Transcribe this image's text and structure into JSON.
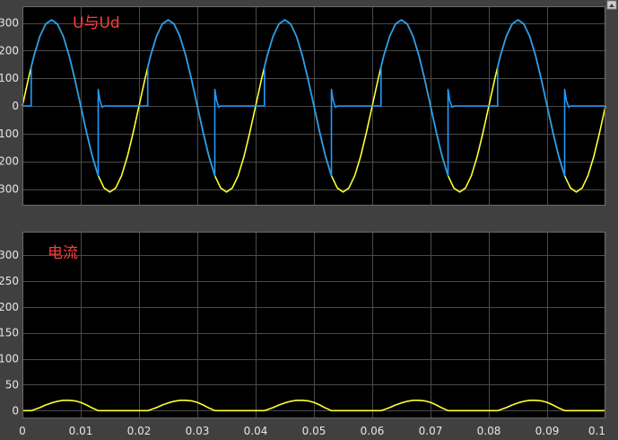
{
  "colors": {
    "background": "#404040",
    "plot_background": "#000000",
    "tick_text": "#e6e6e6",
    "title": "#ff3b3b",
    "yellow": "#ffff33",
    "blue": "#1e9bff"
  },
  "chart_data": [
    {
      "type": "line",
      "title": "U与Ud",
      "xlim": [
        0,
        0.1
      ],
      "ylim": [
        -360,
        360
      ],
      "grid": true,
      "xticks": [
        0,
        0.01,
        0.02,
        0.03,
        0.04,
        0.05,
        0.06,
        0.07,
        0.08,
        0.09,
        0.1
      ],
      "xtick_labels": [
        "0",
        "0.01",
        "0.02",
        "0.03",
        "0.04",
        "0.05",
        "0.06",
        "0.07",
        "0.08",
        "0.09",
        "0.1"
      ],
      "yticks": [
        300,
        200,
        100,
        0,
        -100,
        -200,
        -300
      ],
      "ytick_labels": [
        "300",
        "200",
        "100",
        "0",
        "100",
        "200",
        "300"
      ],
      "series": [
        {
          "color": "yellow",
          "x": [
            0,
            0.001,
            0.002,
            0.003,
            0.004,
            0.005,
            0.006,
            0.007,
            0.008,
            0.009,
            0.01,
            0.011,
            0.012,
            0.013,
            0.014,
            0.015,
            0.016,
            0.017,
            0.018,
            0.019,
            0.02,
            0.021,
            0.022,
            0.023,
            0.024,
            0.025,
            0.026,
            0.027,
            0.028,
            0.029,
            0.03,
            0.031,
            0.032,
            0.033,
            0.034,
            0.035,
            0.036,
            0.037,
            0.038,
            0.039,
            0.04,
            0.041,
            0.042,
            0.043,
            0.044,
            0.045,
            0.046,
            0.047,
            0.048,
            0.049,
            0.05,
            0.051,
            0.052,
            0.053,
            0.054,
            0.055,
            0.056,
            0.057,
            0.058,
            0.059,
            0.06,
            0.061,
            0.062,
            0.063,
            0.064,
            0.065,
            0.066,
            0.067,
            0.068,
            0.069,
            0.07,
            0.071,
            0.072,
            0.073,
            0.074,
            0.075,
            0.076,
            0.077,
            0.078,
            0.079,
            0.08,
            0.081,
            0.082,
            0.083,
            0.084,
            0.085,
            0.086,
            0.087,
            0.088,
            0.089,
            0.09,
            0.091,
            0.092,
            0.093,
            0.094,
            0.095,
            0.096,
            0.097,
            0.098,
            0.099,
            0.1
          ],
          "y": [
            0,
            96,
            183,
            252,
            296,
            311,
            296,
            252,
            183,
            96,
            0,
            -96,
            -183,
            -252,
            -296,
            -311,
            -296,
            -252,
            -183,
            -96,
            0,
            96,
            183,
            252,
            296,
            311,
            296,
            252,
            183,
            96,
            0,
            -96,
            -183,
            -252,
            -296,
            -311,
            -296,
            -252,
            -183,
            -96,
            0,
            96,
            183,
            252,
            296,
            311,
            296,
            252,
            183,
            96,
            0,
            -96,
            -183,
            -252,
            -296,
            -311,
            -296,
            -252,
            -183,
            -96,
            0,
            96,
            183,
            252,
            296,
            311,
            296,
            252,
            183,
            96,
            0,
            -96,
            -183,
            -252,
            -296,
            -311,
            -296,
            -252,
            -183,
            -96,
            0,
            96,
            183,
            252,
            296,
            311,
            296,
            252,
            183,
            96,
            0,
            -96,
            -183,
            -252,
            -296,
            -311,
            -296,
            -252,
            -183,
            -96,
            0
          ]
        },
        {
          "color": "blue",
          "x": [
            0,
            0.0005,
            0.0015,
            0.0015,
            0.002,
            0.003,
            0.004,
            0.005,
            0.006,
            0.007,
            0.008,
            0.009,
            0.01,
            0.011,
            0.012,
            0.013,
            0.013,
            0.0133,
            0.0137,
            0.014,
            0.015,
            0.0215,
            0.0215,
            0.022,
            0.023,
            0.024,
            0.025,
            0.026,
            0.027,
            0.028,
            0.029,
            0.03,
            0.031,
            0.032,
            0.033,
            0.033,
            0.0333,
            0.0337,
            0.034,
            0.035,
            0.0415,
            0.0415,
            0.042,
            0.043,
            0.044,
            0.045,
            0.046,
            0.047,
            0.048,
            0.049,
            0.05,
            0.051,
            0.052,
            0.053,
            0.053,
            0.0533,
            0.0537,
            0.054,
            0.055,
            0.0615,
            0.0615,
            0.062,
            0.063,
            0.064,
            0.065,
            0.066,
            0.067,
            0.068,
            0.069,
            0.07,
            0.071,
            0.072,
            0.073,
            0.073,
            0.0733,
            0.0737,
            0.074,
            0.075,
            0.0815,
            0.0815,
            0.082,
            0.083,
            0.084,
            0.085,
            0.086,
            0.087,
            0.088,
            0.089,
            0.09,
            0.091,
            0.092,
            0.093,
            0.093,
            0.0933,
            0.0937,
            0.094,
            0.095,
            0.1
          ],
          "y": [
            0,
            0,
            0,
            141,
            183,
            252,
            296,
            311,
            296,
            252,
            183,
            96,
            0,
            -96,
            -183,
            -252,
            60,
            20,
            -5,
            0,
            0,
            0,
            141,
            183,
            252,
            296,
            311,
            296,
            252,
            183,
            96,
            0,
            -96,
            -183,
            -252,
            60,
            20,
            -5,
            0,
            0,
            0,
            141,
            183,
            252,
            296,
            311,
            296,
            252,
            183,
            96,
            0,
            -96,
            -183,
            -252,
            60,
            20,
            -5,
            0,
            0,
            0,
            141,
            183,
            252,
            296,
            311,
            296,
            252,
            183,
            96,
            0,
            -96,
            -183,
            -252,
            60,
            20,
            -5,
            0,
            0,
            0,
            141,
            183,
            252,
            296,
            311,
            296,
            252,
            183,
            96,
            0,
            -96,
            -183,
            -252,
            60,
            20,
            -5,
            0,
            0,
            0
          ]
        }
      ]
    },
    {
      "type": "line",
      "title": "电流",
      "xlim": [
        0,
        0.1
      ],
      "ylim": [
        -15,
        345
      ],
      "grid": true,
      "xticks": [
        0,
        0.01,
        0.02,
        0.03,
        0.04,
        0.05,
        0.06,
        0.07,
        0.08,
        0.09,
        0.1
      ],
      "xtick_labels": [
        "0",
        "0.01",
        "0.02",
        "0.03",
        "0.04",
        "0.05",
        "0.06",
        "0.07",
        "0.08",
        "0.09",
        "0.1"
      ],
      "yticks": [
        300,
        250,
        200,
        150,
        100,
        50,
        0
      ],
      "ytick_labels": [
        "300",
        "250",
        "200",
        "150",
        "100",
        "50",
        "0"
      ],
      "series": [
        {
          "color": "yellow",
          "x": [
            0,
            0.0015,
            0.002,
            0.003,
            0.004,
            0.005,
            0.006,
            0.007,
            0.008,
            0.009,
            0.01,
            0.011,
            0.012,
            0.013,
            0.014,
            0.0215,
            0.022,
            0.023,
            0.024,
            0.025,
            0.026,
            0.027,
            0.028,
            0.029,
            0.03,
            0.031,
            0.032,
            0.033,
            0.034,
            0.0415,
            0.042,
            0.043,
            0.044,
            0.045,
            0.046,
            0.047,
            0.048,
            0.049,
            0.05,
            0.051,
            0.052,
            0.053,
            0.054,
            0.0615,
            0.062,
            0.063,
            0.064,
            0.065,
            0.066,
            0.067,
            0.068,
            0.069,
            0.07,
            0.071,
            0.072,
            0.073,
            0.074,
            0.0815,
            0.082,
            0.083,
            0.084,
            0.085,
            0.086,
            0.087,
            0.088,
            0.089,
            0.09,
            0.091,
            0.092,
            0.093,
            0.094,
            0.1
          ],
          "y": [
            0,
            0,
            2,
            6,
            11,
            15,
            18,
            20,
            20,
            19,
            16,
            11,
            5,
            0,
            0,
            0,
            2,
            6,
            11,
            15,
            18,
            20,
            20,
            19,
            16,
            11,
            5,
            0,
            0,
            0,
            2,
            6,
            11,
            15,
            18,
            20,
            20,
            19,
            16,
            11,
            5,
            0,
            0,
            0,
            2,
            6,
            11,
            15,
            18,
            20,
            20,
            19,
            16,
            11,
            5,
            0,
            0,
            0,
            2,
            6,
            11,
            15,
            18,
            20,
            20,
            19,
            16,
            11,
            5,
            0,
            0,
            0
          ]
        }
      ]
    }
  ]
}
